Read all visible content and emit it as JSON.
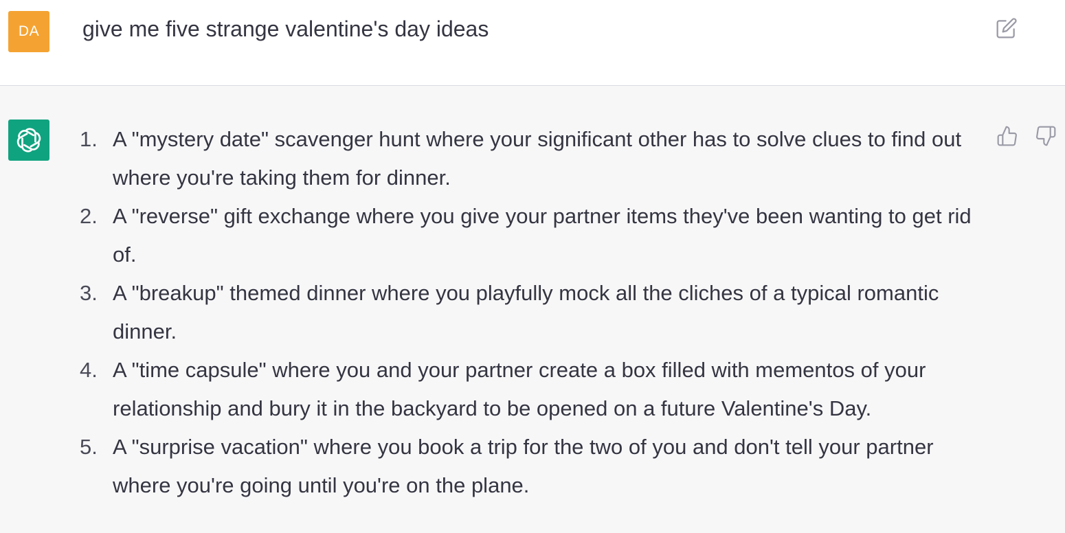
{
  "user_message": {
    "avatar_initials": "DA",
    "text": "give me five strange valentine's day ideas",
    "avatar_color": "#f4a332",
    "edit_icon": "edit-icon"
  },
  "assistant_message": {
    "avatar_icon": "openai-logo-icon",
    "avatar_color": "#10a37f",
    "items": [
      {
        "num": "1.",
        "text": "A \"mystery date\" scavenger hunt where your significant other has to solve clues to find out where you're taking them for dinner."
      },
      {
        "num": "2.",
        "text": "A \"reverse\" gift exchange where you give your partner items they've been wanting to get rid of."
      },
      {
        "num": "3.",
        "text": "A \"breakup\" themed dinner where you playfully mock all the cliches of a typical romantic dinner."
      },
      {
        "num": "4.",
        "text": "A \"time capsule\" where you and your partner create a box filled with mementos of your relationship and bury it in the backyard to be opened on a future Valentine's Day."
      },
      {
        "num": "5.",
        "text": "A \"surprise vacation\" where you book a trip for the two of you and don't tell your partner where you're going until you're on the plane."
      }
    ],
    "feedback_icons": [
      "thumbs-up-icon",
      "thumbs-down-icon"
    ]
  }
}
